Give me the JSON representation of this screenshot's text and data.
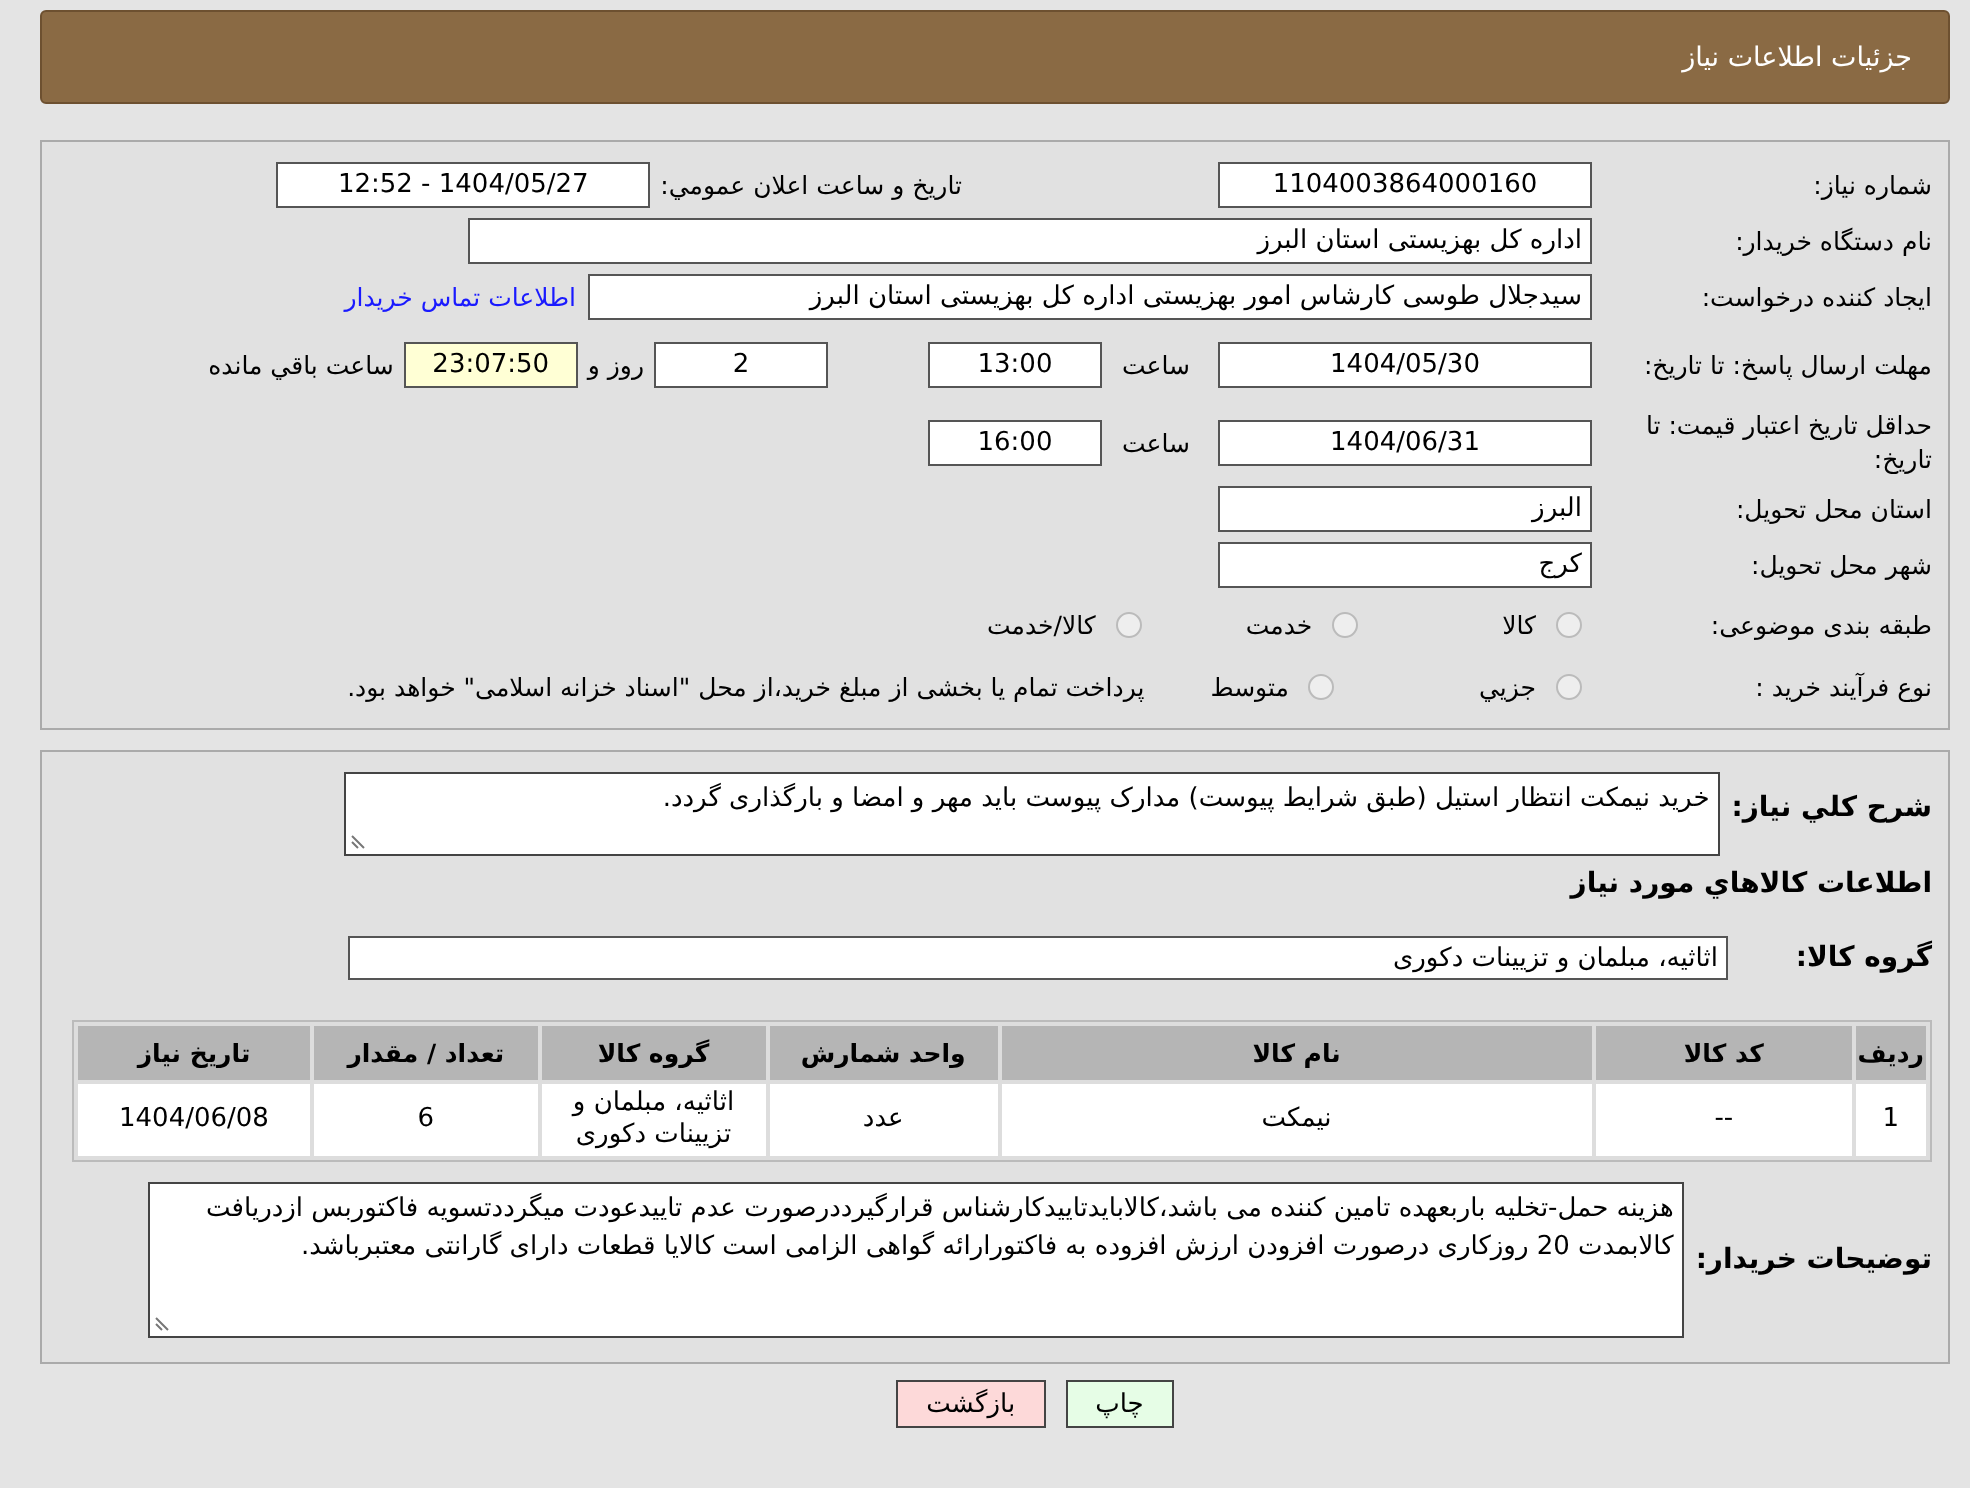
{
  "header": {
    "title": "جزئیات اطلاعات نیاز"
  },
  "details": {
    "need_number": {
      "label": "شماره نیاز:",
      "value": "1104003864000160"
    },
    "announce": {
      "label": "تاريخ و ساعت اعلان عمومي:",
      "value": "1404/05/27 - 12:52"
    },
    "buyer": {
      "label": "نام دستگاه خریدار:",
      "value": "اداره کل بهزیستی استان البرز"
    },
    "requester": {
      "label": "ایجاد کننده درخواست:",
      "value": "سیدجلال طوسی کارشاس امور بهزیستی اداره کل بهزیستی استان البرز",
      "link": "اطلاعات تماس خریدار"
    },
    "reply_deadline": {
      "label": "مهلت ارسال پاسخ: تا تاریخ:",
      "date": "1404/05/30",
      "time_label": "ساعت",
      "time": "13:00",
      "days": "2",
      "days_label": "روز و",
      "remaining": "23:07:50",
      "remaining_label": "ساعت باقي مانده"
    },
    "price_validity": {
      "label": "حداقل تاریخ اعتبار قیمت: تا تاریخ:",
      "date": "1404/06/31",
      "time_label": "ساعت",
      "time": "16:00"
    },
    "province": {
      "label": "استان محل تحویل:",
      "value": "البرز"
    },
    "city": {
      "label": "شهر محل تحویل:",
      "value": "کرج"
    },
    "category": {
      "label": "طبقه بندی موضوعی:",
      "options": [
        {
          "label": "کالا",
          "selected": false
        },
        {
          "label": "خدمت",
          "selected": false
        },
        {
          "label": "کالا/خدمت",
          "selected": false
        }
      ]
    },
    "process": {
      "label": "نوع فرآیند خرید :",
      "options": [
        {
          "label": "جزيي",
          "selected": false
        },
        {
          "label": "متوسط",
          "selected": false
        }
      ],
      "note": "پرداخت تمام یا بخشی از مبلغ خرید،از محل \"اسناد خزانه اسلامی\" خواهد بود."
    }
  },
  "items": {
    "description": {
      "label": "شرح کلي نیاز:",
      "value": "خرید نیمکت انتظار استیل (طبق شرایط پیوست) مدارک پیوست باید مهر و امضا و بارگذاری گردد."
    },
    "section_title": "اطلاعات کالاهاي مورد نیاز",
    "group": {
      "label": "گروه کالا:",
      "value": "اثاثیه، مبلمان و تزیینات دکوری"
    },
    "table": {
      "columns": [
        "ردیف",
        "کد کالا",
        "نام کالا",
        "واحد شمارش",
        "گروه کالا",
        "تعداد / مقدار",
        "تاریخ نیاز"
      ],
      "rows": [
        [
          "1",
          "--",
          "نیمکت",
          "عدد",
          "اثاثیه، مبلمان و تزیینات دکوری",
          "6",
          "1404/06/08"
        ]
      ]
    },
    "notes": {
      "label": "توضیحات خریدار:",
      "value": "هزینه حمل-تخلیه باربعهده تامین کننده می باشد،کالاباید‌تاییدکارشناس قرارگیرددرصورت عدم تاییدعودت میگرددتسویه فاکتوربس ازدریافت کالابمدت 20 روزکاری درصورت افزودن ارزش افزوده به فاکتورارائه گواهی الزامی است کالایا قطعات دارای گارانتی معتبرباشد."
    }
  },
  "buttons": [
    {
      "label": "چاپ",
      "kind": "print"
    },
    {
      "label": "بازگشت",
      "kind": "back"
    }
  ]
}
